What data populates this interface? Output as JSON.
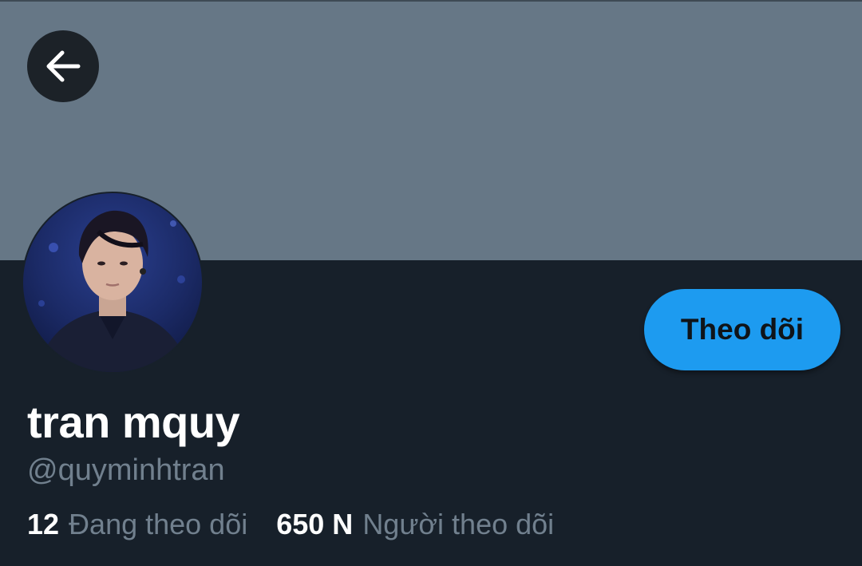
{
  "profile": {
    "display_name": "tran mquy",
    "handle": "@quyminhtran",
    "follow_button_label": "Theo dõi",
    "following_count": "12",
    "following_label": "Đang theo dõi",
    "followers_count": "650 N",
    "followers_label": "Người theo dõi"
  },
  "icons": {
    "back": "arrow-left-icon"
  },
  "colors": {
    "banner": "#667786",
    "background": "#17202a",
    "accent": "#1d9bf0",
    "muted_text": "#71808e"
  }
}
